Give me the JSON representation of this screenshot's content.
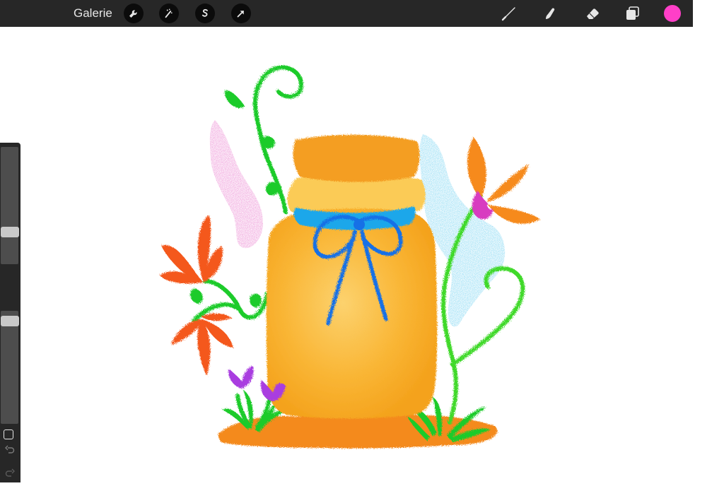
{
  "toolbar": {
    "gallery_label": "Galerie",
    "actions": [
      {
        "name": "actions-wrench-icon"
      },
      {
        "name": "adjustments-wand-icon"
      },
      {
        "name": "selection-s-icon"
      },
      {
        "name": "transform-arrow-icon"
      }
    ],
    "tools": [
      {
        "name": "brush-icon"
      },
      {
        "name": "smudge-icon"
      },
      {
        "name": "eraser-icon"
      },
      {
        "name": "layers-icon"
      }
    ],
    "current_color": "#ff3fc8"
  },
  "sidebar": {
    "brush_size_level": 0.25,
    "opacity_level": 0.95
  },
  "canvas": {
    "subject": "jar-with-flowers"
  }
}
